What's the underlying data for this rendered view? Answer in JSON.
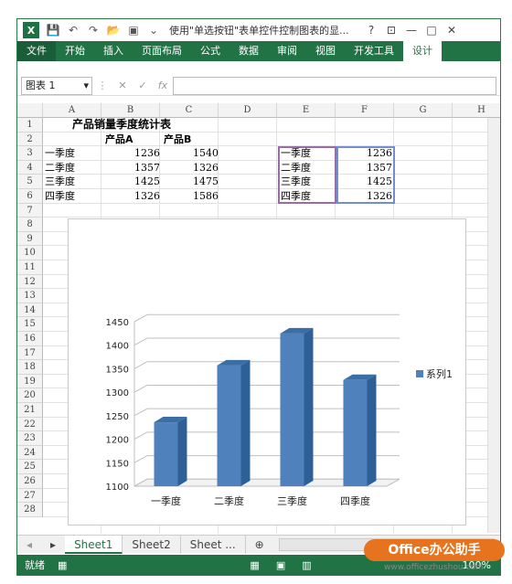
{
  "titlebar": {
    "logo": "X",
    "title": "使用\"单选按钮\"表单控件控制图表的显...",
    "help": "?",
    "restore": "⊡",
    "minimize": "—",
    "maximize": "□",
    "close": "✕"
  },
  "ribbon": {
    "tabs": [
      "文件",
      "开始",
      "插入",
      "页面布局",
      "公式",
      "数据",
      "审阅",
      "视图",
      "开发工具",
      "设计"
    ]
  },
  "formula_bar": {
    "name_box": "图表 1",
    "fx": "fx"
  },
  "columns": [
    "A",
    "B",
    "C",
    "D",
    "E",
    "F",
    "G",
    "H"
  ],
  "rows": [
    "1",
    "2",
    "3",
    "4",
    "5",
    "6",
    "7",
    "8",
    "9",
    "10",
    "11",
    "12",
    "13",
    "14",
    "15",
    "16",
    "17",
    "18",
    "19",
    "20",
    "21",
    "22",
    "23",
    "24",
    "25",
    "26",
    "27",
    "28"
  ],
  "sheet": {
    "title": "产品销量季度统计表",
    "header_a": "产品A",
    "header_b": "产品B",
    "table": [
      {
        "q": "一季度",
        "a": "1236",
        "b": "1540"
      },
      {
        "q": "二季度",
        "a": "1357",
        "b": "1326"
      },
      {
        "q": "三季度",
        "a": "1425",
        "b": "1475"
      },
      {
        "q": "四季度",
        "a": "1326",
        "b": "1586"
      }
    ],
    "aux": [
      {
        "q": "一季度",
        "v": "1236"
      },
      {
        "q": "二季度",
        "v": "1357"
      },
      {
        "q": "三季度",
        "v": "1425"
      },
      {
        "q": "四季度",
        "v": "1326"
      }
    ]
  },
  "chart_data": {
    "type": "bar",
    "categories": [
      "一季度",
      "二季度",
      "三季度",
      "四季度"
    ],
    "series": [
      {
        "name": "系列1",
        "values": [
          1236,
          1357,
          1425,
          1326
        ]
      }
    ],
    "yticks": [
      "1100",
      "1150",
      "1200",
      "1250",
      "1300",
      "1350",
      "1400",
      "1450"
    ],
    "ylim": [
      1100,
      1450
    ],
    "grid": true,
    "legend_position": "right",
    "bar_color": "#4f81bd"
  },
  "sheet_tabs": [
    "Sheet1",
    "Sheet2",
    "Sheet ..."
  ],
  "status": {
    "ready": "就绪",
    "zoom": "100%"
  },
  "watermark": {
    "text": "Office办公助手",
    "url": "www.officezhushou.com"
  }
}
